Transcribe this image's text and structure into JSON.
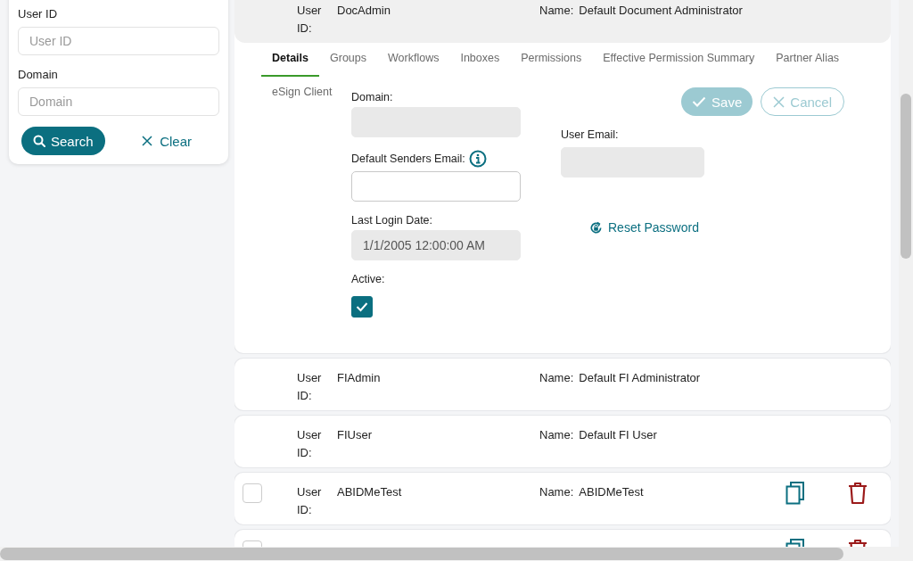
{
  "search_panel": {
    "fields": [
      {
        "label": "User ID",
        "placeholder": "User ID"
      },
      {
        "label": "Domain",
        "placeholder": "Domain"
      }
    ],
    "search_button": "Search",
    "clear_button": "Clear"
  },
  "users": [
    {
      "kind": "builtin",
      "user_id_label": "User ID:",
      "user_id": "DocAdmin",
      "name_label": "Name:",
      "name": "Default Document Administrator",
      "expanded": true
    },
    {
      "kind": "builtin",
      "user_id_label": "User ID:",
      "user_id": "FIAdmin",
      "name_label": "Name:",
      "name": "Default FI Administrator",
      "expanded": false
    },
    {
      "kind": "builtin",
      "user_id_label": "User ID:",
      "user_id": "FIUser",
      "name_label": "Name:",
      "name": "Default FI User",
      "expanded": false
    },
    {
      "kind": "editable",
      "user_id_label": "User ID:",
      "user_id": "ABIDMeTest",
      "name_label": "Name:",
      "name": "ABIDMeTest",
      "expanded": false,
      "checked": false
    },
    {
      "kind": "editable",
      "expanded": false
    }
  ],
  "details": {
    "tabs": [
      {
        "label": "Details",
        "selected": true
      },
      {
        "label": "Groups",
        "selected": false
      },
      {
        "label": "Workflows",
        "selected": false
      },
      {
        "label": "Inboxes",
        "selected": false
      },
      {
        "label": "Permissions",
        "selected": false
      },
      {
        "label": "Effective Permission Summary",
        "selected": false
      },
      {
        "label": "Partner Alias",
        "selected": false
      },
      {
        "label": "eSign Client",
        "selected": false
      }
    ],
    "save_button": {
      "label": "Save",
      "disabled": true
    },
    "cancel_button": {
      "label": "Cancel",
      "disabled": true
    },
    "left_fields": [
      {
        "kind": "input",
        "label": "Domain:",
        "disabled": true
      },
      {
        "kind": "input",
        "label": "Default Senders Email:",
        "disabled": false,
        "info": true
      },
      {
        "kind": "input",
        "label": "Last Login Date:",
        "disabled": true,
        "value": "1/1/2005 12:00:00 AM"
      },
      {
        "kind": "checkbox",
        "label": "Active:",
        "checked": true
      }
    ],
    "right_fields": [
      {
        "kind": "input",
        "label": "User Email:",
        "disabled": true
      }
    ],
    "reset_password_link": "Reset Password"
  }
}
